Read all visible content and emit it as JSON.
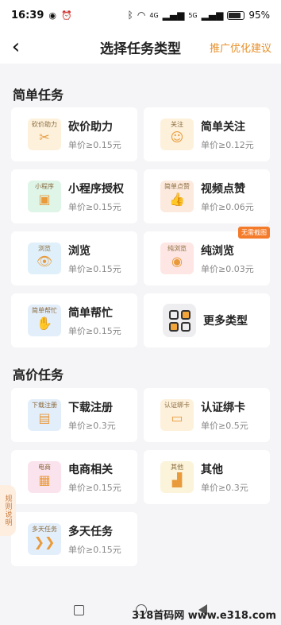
{
  "status": {
    "time": "16:39",
    "battery": "95%",
    "net1": "4G",
    "net2": "5G"
  },
  "nav": {
    "title": "选择任务类型",
    "action": "推广优化建议"
  },
  "sections": {
    "simple": "简单任务",
    "high": "高价任务"
  },
  "simple_cards": [
    {
      "name": "砍价助力",
      "price": "单价≥0.15元",
      "icon_label": "砍价助力",
      "icon_glyph": "✂"
    },
    {
      "name": "简单关注",
      "price": "单价≥0.12元",
      "icon_label": "关注",
      "icon_glyph": "☺"
    },
    {
      "name": "小程序授权",
      "price": "单价≥0.15元",
      "icon_label": "小程序",
      "icon_glyph": "▣"
    },
    {
      "name": "视频点赞",
      "price": "单价≥0.06元",
      "icon_label": "简单点赞",
      "icon_glyph": "👍"
    },
    {
      "name": "浏览",
      "price": "单价≥0.15元",
      "icon_label": "浏览",
      "icon_glyph": "👁"
    },
    {
      "name": "纯浏览",
      "price": "单价≥0.03元",
      "icon_label": "纯浏览",
      "icon_glyph": "◉",
      "tag": "无需截图"
    },
    {
      "name": "简单帮忙",
      "price": "单价≥0.15元",
      "icon_label": "简单帮忙",
      "icon_glyph": "✋"
    },
    {
      "name": "更多类型"
    }
  ],
  "high_cards": [
    {
      "name": "下载注册",
      "price": "单价≥0.3元",
      "icon_label": "下载注册",
      "icon_glyph": "▤"
    },
    {
      "name": "认证绑卡",
      "price": "单价≥0.5元",
      "icon_label": "认证绑卡",
      "icon_glyph": "▭"
    },
    {
      "name": "电商相关",
      "price": "单价≥0.15元",
      "icon_label": "电商",
      "icon_glyph": "▦"
    },
    {
      "name": "其他",
      "price": "单价≥0.3元",
      "icon_label": "其他",
      "icon_glyph": "▟"
    },
    {
      "name": "多天任务",
      "price": "单价≥0.15元",
      "icon_label": "多天任务",
      "icon_glyph": "❯❯"
    }
  ],
  "side_tab": "规则说明",
  "watermark": "318首码网 www.e318.com",
  "colors": {
    "accent": "#e8912d",
    "tag": "#f47b2a",
    "icon_bg": [
      "#fdf1dc",
      "#fdf1dc",
      "#def5e8",
      "#fdeade",
      "#dff0fb",
      "#fde6e3",
      "#e3eefb",
      "#e3eefb",
      "#fdf1dc",
      "#fbe3ee",
      "#fbf4da",
      "#e3eefb"
    ]
  }
}
